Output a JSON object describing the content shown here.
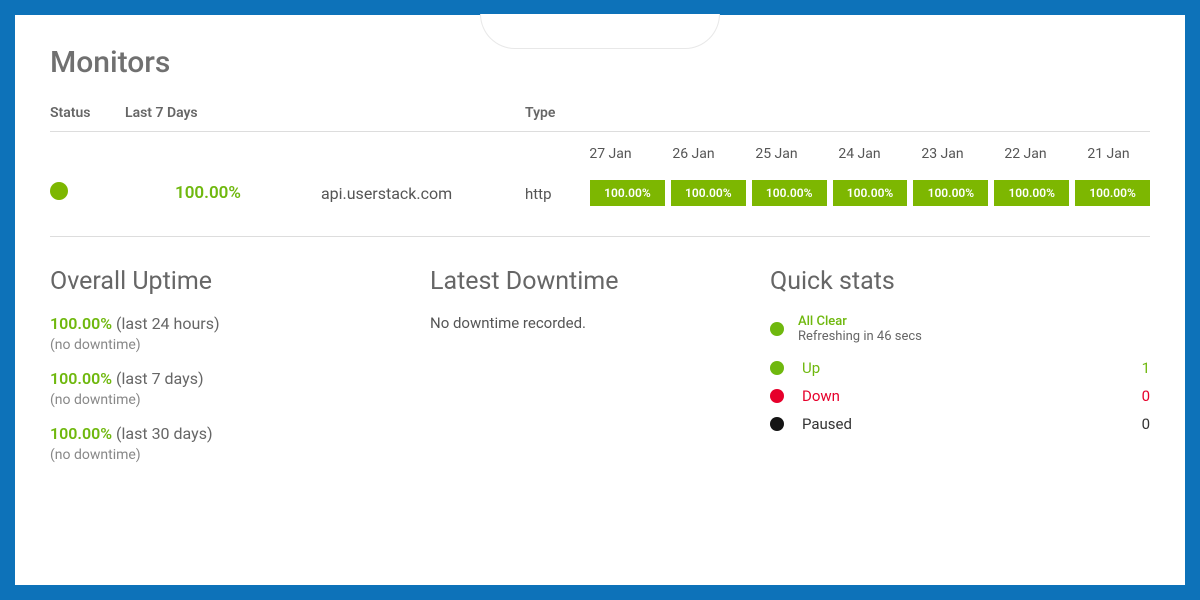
{
  "page_title": "Monitors",
  "headers": {
    "status": "Status",
    "last7days": "Last 7 Days",
    "type": "Type"
  },
  "dates": [
    "27 Jan",
    "26 Jan",
    "25 Jan",
    "24 Jan",
    "23 Jan",
    "22 Jan",
    "21 Jan"
  ],
  "monitor": {
    "uptime_pct": "100.00%",
    "name": "api.userstack.com",
    "type": "http",
    "bars": [
      "100.00%",
      "100.00%",
      "100.00%",
      "100.00%",
      "100.00%",
      "100.00%",
      "100.00%"
    ]
  },
  "overall_uptime": {
    "title": "Overall Uptime",
    "rows": [
      {
        "pct": "100.00%",
        "period": "(last 24 hours)",
        "note": "(no downtime)"
      },
      {
        "pct": "100.00%",
        "period": "(last 7 days)",
        "note": "(no downtime)"
      },
      {
        "pct": "100.00%",
        "period": "(last 30 days)",
        "note": "(no downtime)"
      }
    ]
  },
  "latest_downtime": {
    "title": "Latest Downtime",
    "message": "No downtime recorded."
  },
  "quick_stats": {
    "title": "Quick stats",
    "all_clear": "All Clear",
    "refreshing": "Refreshing in 46 secs",
    "up_label": "Up",
    "up_count": "1",
    "down_label": "Down",
    "down_count": "0",
    "paused_label": "Paused",
    "paused_count": "0"
  }
}
